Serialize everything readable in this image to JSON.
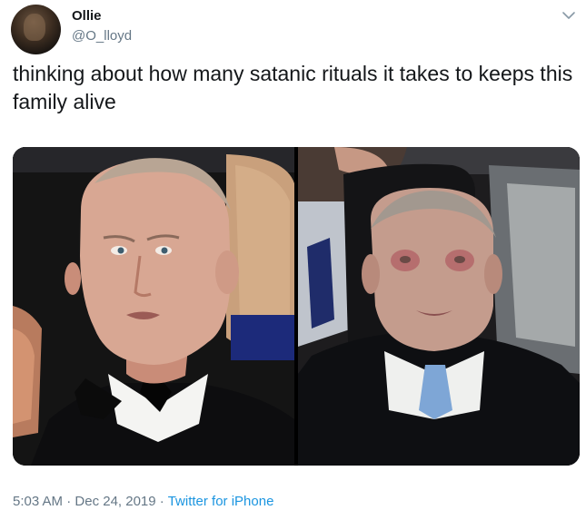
{
  "tweet": {
    "author_name": "Ollie",
    "author_handle": "@O_lloyd",
    "text": "thinking about how many satanic rituals it takes to keeps this family alive",
    "time": "5:03 AM",
    "separator": "·",
    "date": "Dec 24, 2019",
    "source": "Twitter for iPhone"
  },
  "icons": {
    "menu": "chevron-down-icon"
  },
  "colors": {
    "text": "#14171a",
    "secondary": "#657786",
    "link": "#1b95e0"
  }
}
